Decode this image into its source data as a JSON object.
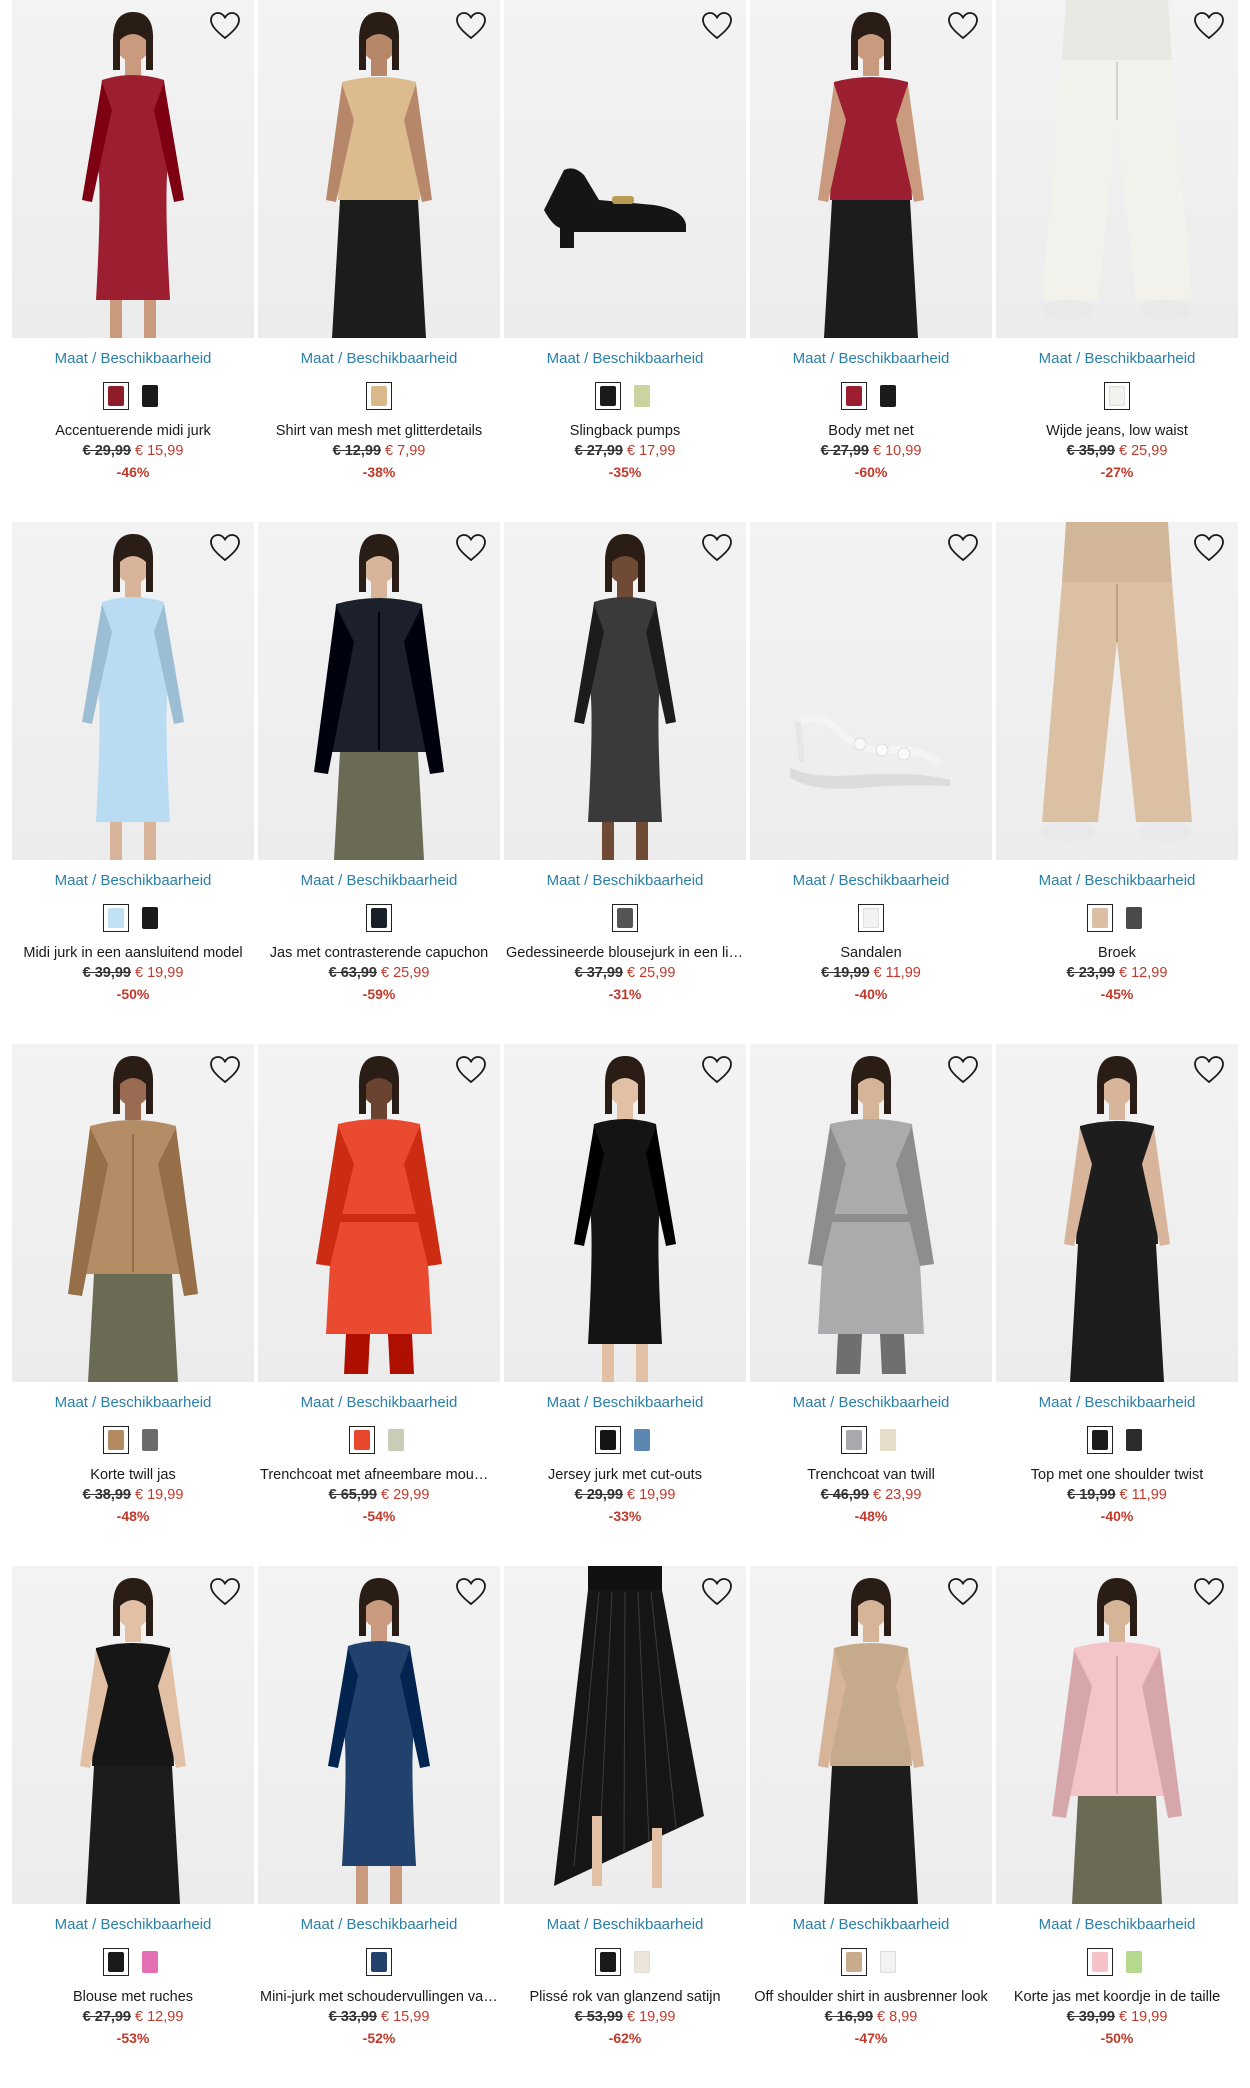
{
  "heart_icon": "heart-outline-icon",
  "products": [
    {
      "size_label": "Maat / Beschikbaarheid",
      "name": "Accentuerende midi jurk",
      "old_price": "€ 29,99",
      "new_price": "€ 15,99",
      "discount": "-46%",
      "kind": "dress",
      "colors": [
        "#8e1d2c",
        "#1a1a1a"
      ],
      "primary": "#9b1f30",
      "skin": "#c99a7e"
    },
    {
      "size_label": "Maat / Beschikbaarheid",
      "name": "Shirt van mesh met glitterdetails",
      "old_price": "€ 12,99",
      "new_price": "€ 7,99",
      "discount": "-38%",
      "kind": "top",
      "colors": [
        "#d9b98c"
      ],
      "primary": "#dcbb8f",
      "skin": "#b7876a"
    },
    {
      "size_label": "Maat / Beschikbaarheid",
      "name": "Slingback pumps",
      "old_price": "€ 27,99",
      "new_price": "€ 17,99",
      "discount": "-35%",
      "kind": "shoe",
      "colors": [
        "#1a1a1a",
        "#c9d4a0"
      ],
      "primary": "#151515",
      "skin": ""
    },
    {
      "size_label": "Maat / Beschikbaarheid",
      "name": "Body met net",
      "old_price": "€ 27,99",
      "new_price": "€ 10,99",
      "discount": "-60%",
      "kind": "top",
      "colors": [
        "#9b1f30",
        "#1a1a1a"
      ],
      "primary": "#9b1f30",
      "skin": "#c99a7e"
    },
    {
      "size_label": "Maat / Beschikbaarheid",
      "name": "Wijde jeans, low waist",
      "old_price": "€ 35,99",
      "new_price": "€ 25,99",
      "discount": "-27%",
      "kind": "pants",
      "colors": [
        "#f4f2ee"
      ],
      "primary": "#f3f1ec",
      "skin": "#d6b59a"
    },
    {
      "size_label": "Maat / Beschikbaarheid",
      "name": "Midi jurk in een aansluitend model",
      "old_price": "€ 39,99",
      "new_price": "€ 19,99",
      "discount": "-50%",
      "kind": "dress",
      "colors": [
        "#bfe0f5",
        "#1a1a1a"
      ],
      "primary": "#b9dcf3",
      "skin": "#d8b49a"
    },
    {
      "size_label": "Maat / Beschikbaarheid",
      "name": "Jas met contrasterende capuchon",
      "old_price": "€ 63,99",
      "new_price": "€ 25,99",
      "discount": "-59%",
      "kind": "jacket",
      "colors": [
        "#1b1f2a"
      ],
      "primary": "#1c202b",
      "skin": "#d8b49a"
    },
    {
      "size_label": "Maat / Beschikbaarheid",
      "name": "Gedessineerde blousejurk in een lichte kwaliteit",
      "old_price": "€ 37,99",
      "new_price": "€ 25,99",
      "discount": "-31%",
      "kind": "dress",
      "colors": [
        "#555555"
      ],
      "primary": "#3a3a3a",
      "skin": "#6f4a35"
    },
    {
      "size_label": "Maat / Beschikbaarheid",
      "name": "Sandalen",
      "old_price": "€ 19,99",
      "new_price": "€ 11,99",
      "discount": "-40%",
      "kind": "sandal",
      "colors": [
        "#f2f2f2"
      ],
      "primary": "#f4f4f4",
      "skin": ""
    },
    {
      "size_label": "Maat / Beschikbaarheid",
      "name": "Broek",
      "old_price": "€ 23,99",
      "new_price": "€ 12,99",
      "discount": "-45%",
      "kind": "pants",
      "colors": [
        "#dcbfa2",
        "#4a4a4a"
      ],
      "primary": "#dcc0a3",
      "skin": "#d8b49a"
    },
    {
      "size_label": "Maat / Beschikbaarheid",
      "name": "Korte twill jas",
      "old_price": "€ 38,99",
      "new_price": "€ 19,99",
      "discount": "-48%",
      "kind": "jacket",
      "colors": [
        "#b48a63",
        "#6b6b6b"
      ],
      "primary": "#b48c66",
      "skin": "#9a6b52"
    },
    {
      "size_label": "Maat / Beschikbaarheid",
      "name": "Trenchcoat met afneembare mouwen",
      "old_price": "€ 65,99",
      "new_price": "€ 29,99",
      "discount": "-54%",
      "kind": "coat",
      "colors": [
        "#e8472e",
        "#c9cdb8"
      ],
      "primary": "#ea4b30",
      "skin": "#6b4331"
    },
    {
      "size_label": "Maat / Beschikbaarheid",
      "name": "Jersey jurk met cut-outs",
      "old_price": "€ 29,99",
      "new_price": "€ 19,99",
      "discount": "-33%",
      "kind": "dress",
      "colors": [
        "#141414",
        "#5b87b0"
      ],
      "primary": "#141414",
      "skin": "#e2c0a5"
    },
    {
      "size_label": "Maat / Beschikbaarheid",
      "name": "Trenchcoat van twill",
      "old_price": "€ 46,99",
      "new_price": "€ 23,99",
      "discount": "-48%",
      "kind": "coat",
      "colors": [
        "#a7a9ab",
        "#e6dcc8"
      ],
      "primary": "#a9abad",
      "skin": "#d6b498"
    },
    {
      "size_label": "Maat / Beschikbaarheid",
      "name": "Top met one shoulder twist",
      "old_price": "€ 19,99",
      "new_price": "€ 11,99",
      "discount": "-40%",
      "kind": "top",
      "colors": [
        "#1a1a1a",
        "#2c2c2c"
      ],
      "primary": "#1d1d1d",
      "skin": "#d8b49a"
    },
    {
      "size_label": "Maat / Beschikbaarheid",
      "name": "Blouse met ruches",
      "old_price": "€ 27,99",
      "new_price": "€ 12,99",
      "discount": "-53%",
      "kind": "top",
      "colors": [
        "#1a1a1a",
        "#e46fb4"
      ],
      "primary": "#161616",
      "skin": "#e2c0a5"
    },
    {
      "size_label": "Maat / Beschikbaarheid",
      "name": "Mini-jurk met schoudervullingen van zacht sweatmateriaal",
      "old_price": "€ 33,99",
      "new_price": "€ 15,99",
      "discount": "-52%",
      "kind": "dress",
      "colors": [
        "#23416d"
      ],
      "primary": "#22426e",
      "skin": "#c99a7e"
    },
    {
      "size_label": "Maat / Beschikbaarheid",
      "name": "Plissé rok van glanzend satijn",
      "old_price": "€ 53,99",
      "new_price": "€ 19,99",
      "discount": "-62%",
      "kind": "skirt",
      "colors": [
        "#1a1a1a",
        "#ece6da"
      ],
      "primary": "#161616",
      "skin": "#e2c0a5"
    },
    {
      "size_label": "Maat / Beschikbaarheid",
      "name": "Off shoulder shirt in ausbrenner look",
      "old_price": "€ 16,99",
      "new_price": "€ 8,99",
      "discount": "-47%",
      "kind": "top",
      "colors": [
        "#c8ab8c",
        "#f2f2f2"
      ],
      "primary": "#c6aa8c",
      "skin": "#d6b498"
    },
    {
      "size_label": "Maat / Beschikbaarheid",
      "name": "Korte jas met koordje in de taille",
      "old_price": "€ 39,99",
      "new_price": "€ 19,99",
      "discount": "-50%",
      "kind": "jacket",
      "colors": [
        "#f4c2c7",
        "#b6d88e"
      ],
      "primary": "#f5c4c8",
      "skin": "#d6b498"
    }
  ]
}
